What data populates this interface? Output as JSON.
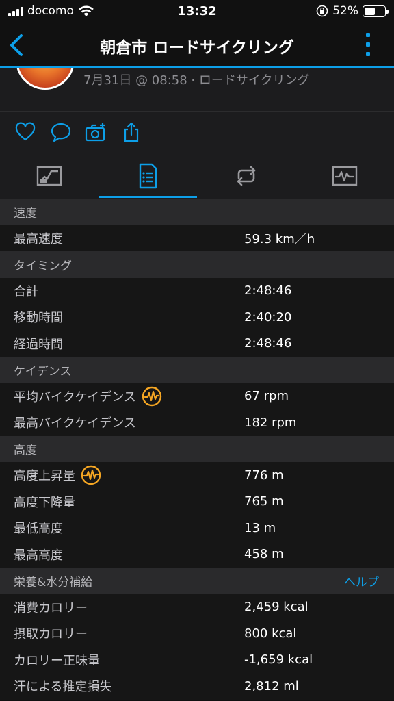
{
  "status_bar": {
    "carrier": "docomo",
    "time": "13:32",
    "battery": "52%",
    "battery_level": 0.52
  },
  "nav": {
    "title": "朝倉市 ロードサイクリング"
  },
  "activity": {
    "meta": "7月31日 @ 08:58 · ロードサイクリング"
  },
  "colors": {
    "accent": "#0d9fe8",
    "badge": "#f5a623",
    "background": "#111111"
  },
  "tabs": [
    {
      "icon": "stats-chart-icon",
      "active": false
    },
    {
      "icon": "document-list-icon",
      "active": true
    },
    {
      "icon": "laps-loop-icon",
      "active": false
    },
    {
      "icon": "activity-graph-icon",
      "active": false
    }
  ],
  "sections": [
    {
      "title": "速度",
      "rows": [
        {
          "label": "最高速度",
          "value": "59.3 km／h"
        }
      ]
    },
    {
      "title": "タイミング",
      "rows": [
        {
          "label": "合計",
          "value": "2:48:46"
        },
        {
          "label": "移動時間",
          "value": "2:40:20"
        },
        {
          "label": "経過時間",
          "value": "2:48:46"
        }
      ]
    },
    {
      "title": "ケイデンス",
      "rows": [
        {
          "label": "平均バイクケイデンス",
          "value": "67 rpm",
          "badge": true
        },
        {
          "label": "最高バイクケイデンス",
          "value": "182 rpm"
        }
      ]
    },
    {
      "title": "高度",
      "rows": [
        {
          "label": "高度上昇量",
          "value": "776 m",
          "badge": true
        },
        {
          "label": "高度下降量",
          "value": "765 m"
        },
        {
          "label": "最低高度",
          "value": "13 m"
        },
        {
          "label": "最高高度",
          "value": "458 m"
        }
      ]
    },
    {
      "title": "栄養&水分補給",
      "help": "ヘルプ",
      "rows": [
        {
          "label": "消費カロリー",
          "value": "2,459 kcal"
        },
        {
          "label": "摂取カロリー",
          "value": "800 kcal"
        },
        {
          "label": "カロリー正味量",
          "value": "-1,659 kcal"
        },
        {
          "label": "汗による推定損失",
          "value": "2,812 ml"
        }
      ]
    }
  ]
}
